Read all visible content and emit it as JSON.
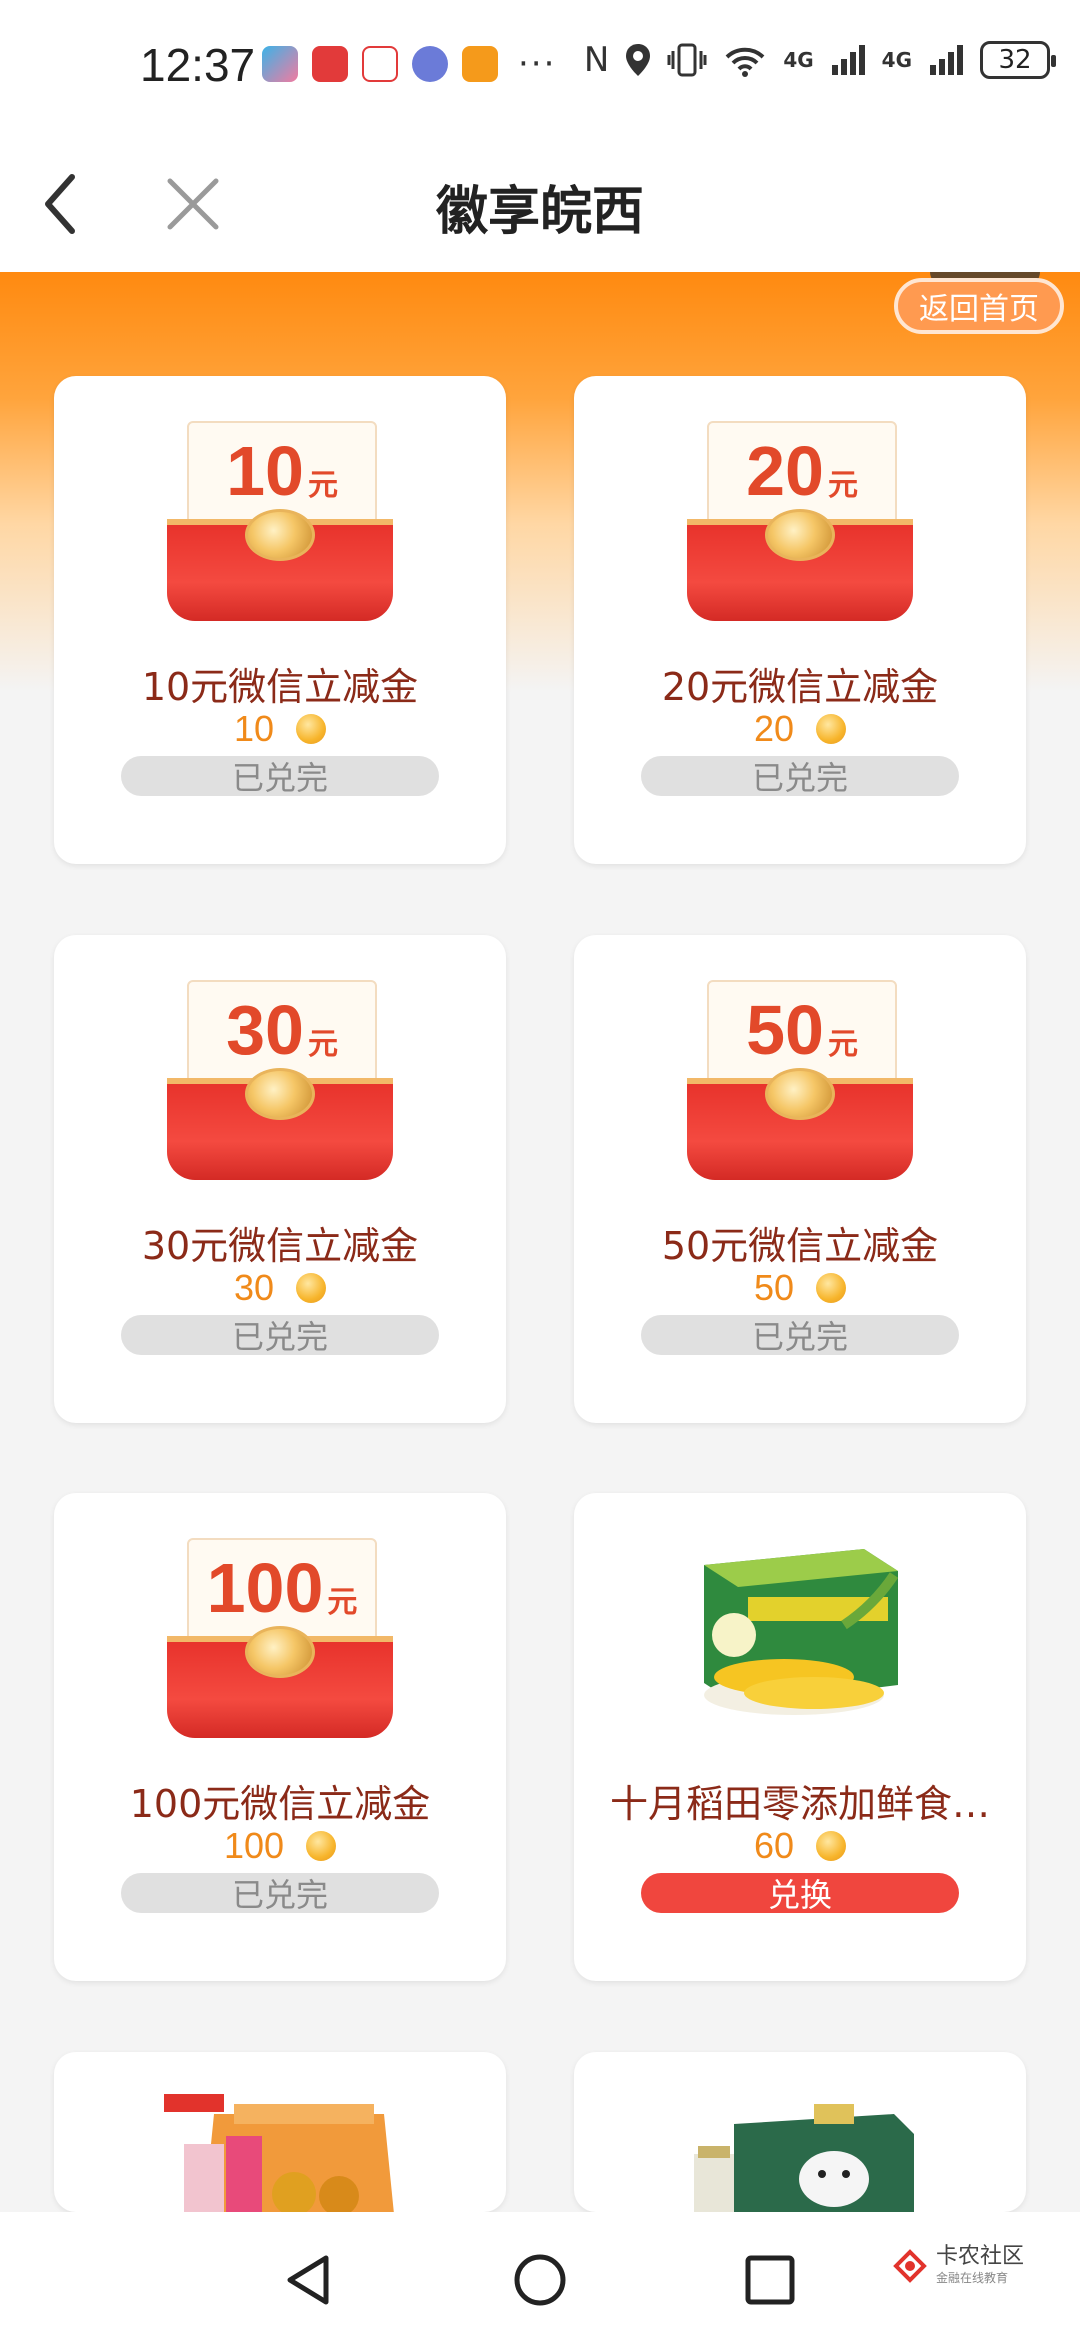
{
  "status_bar": {
    "time": "12:37",
    "more": "···",
    "signal_1": "4G",
    "signal_2": "4G",
    "battery": "32"
  },
  "nav": {
    "title": "徽享皖西"
  },
  "home_button": "返回首页",
  "items": [
    {
      "amount": "10",
      "unit": "元",
      "title": "10元微信立减金",
      "price": "10",
      "status": "已兑完"
    },
    {
      "amount": "20",
      "unit": "元",
      "title": "20元微信立减金",
      "price": "20",
      "status": "已兑完"
    },
    {
      "amount": "30",
      "unit": "元",
      "title": "30元微信立减金",
      "price": "30",
      "status": "已兑完"
    },
    {
      "amount": "50",
      "unit": "元",
      "title": "50元微信立减金",
      "price": "50",
      "status": "已兑完"
    },
    {
      "amount": "100",
      "unit": "元",
      "title": "100元微信立减金",
      "price": "100",
      "status": "已兑完"
    },
    {
      "title": "十月稻田零添加鲜食…",
      "price": "60",
      "status": "兑换"
    }
  ],
  "watermark": {
    "text": "卡农社区",
    "sub": "金融在线教育"
  },
  "colors": {
    "accent_orange": "#ff8a10",
    "coupon_red": "#e8332c",
    "title_brown": "#8b2a18",
    "price_orange": "#f08a1a",
    "exchange_red": "#f0463e",
    "sold_out_gray": "#e0e0e0"
  }
}
